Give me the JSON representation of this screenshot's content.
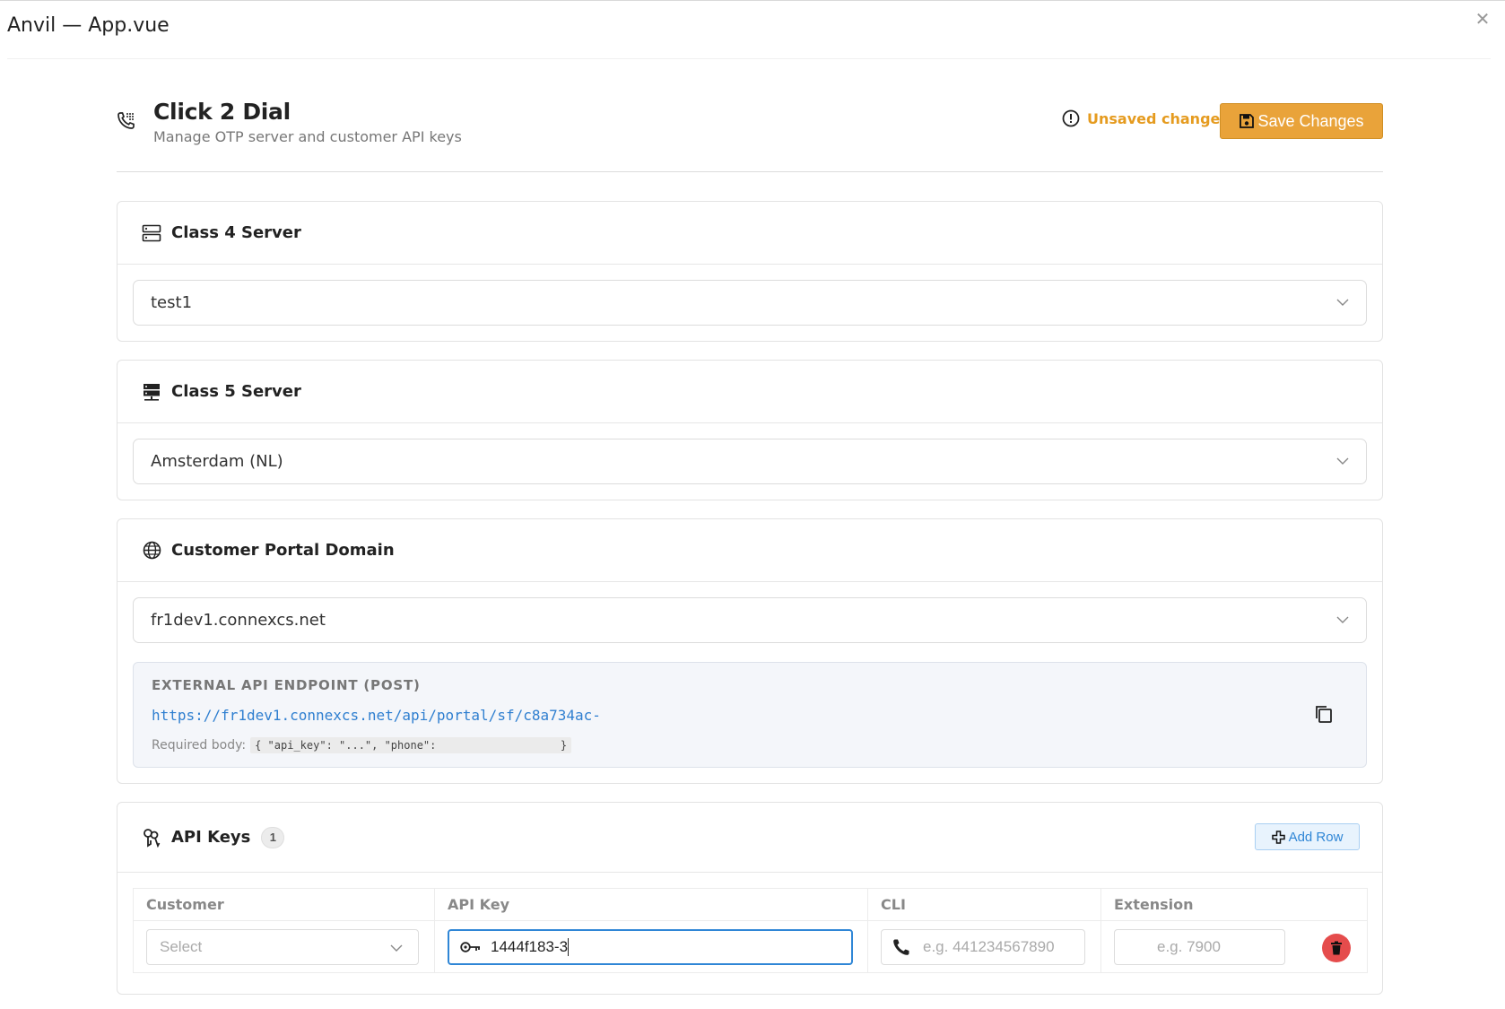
{
  "window": {
    "title": "Anvil — App.vue",
    "close_icon": "close-icon"
  },
  "header": {
    "title": "Click 2 Dial",
    "subtitle": "Manage OTP server and customer API keys",
    "unsaved_text": "Unsaved changes",
    "save_label": "Save Changes",
    "accent_color": "#e9a33a"
  },
  "class4": {
    "label": "Class 4 Server",
    "value": "test1"
  },
  "class5": {
    "label": "Class 5 Server",
    "value": "Amsterdam (NL)"
  },
  "portal": {
    "label": "Customer Portal Domain",
    "value": "fr1dev1.connexcs.net",
    "endpoint_label": "EXTERNAL API ENDPOINT (POST)",
    "endpoint_url": "https://fr1dev1.connexcs.net/api/portal/sf/c8a734ac-",
    "body_label": "Required body:",
    "body_code_start": "{ \"api_key\": \"...\", \"phone\":",
    "body_code_end": "}"
  },
  "api_keys": {
    "label": "API Keys",
    "count": "1",
    "add_row_label": "Add Row",
    "columns": [
      "Customer",
      "API Key",
      "CLI",
      "Extension"
    ],
    "rows": [
      {
        "customer_placeholder": "Select",
        "api_key_value": "1444f183-3",
        "cli_placeholder": "e.g. 441234567890",
        "extension_placeholder": "e.g. 7900"
      }
    ]
  }
}
